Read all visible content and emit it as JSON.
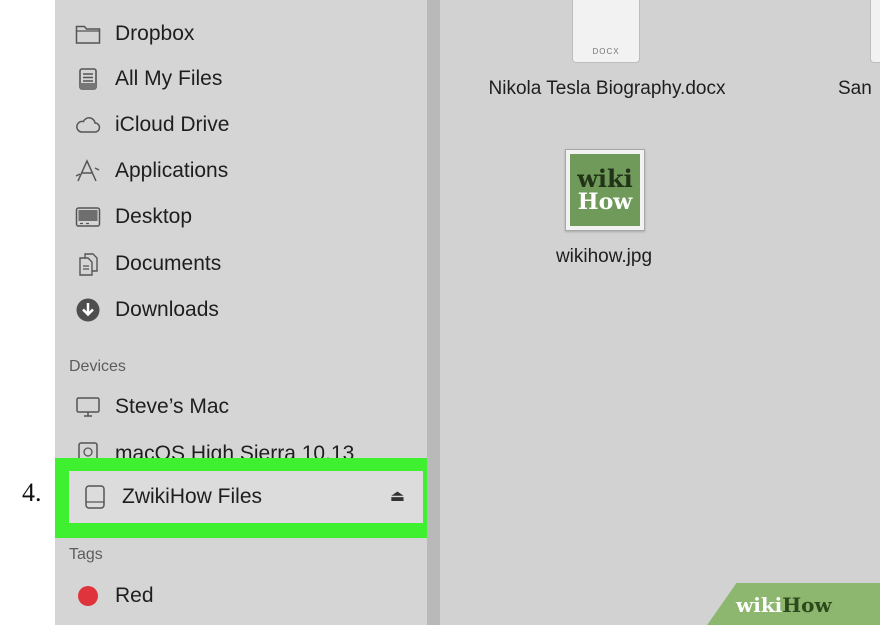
{
  "step": {
    "number": "4."
  },
  "sidebar": {
    "favorites": [
      {
        "label": "Dropbox",
        "icon": "folder-icon"
      },
      {
        "label": "All My Files",
        "icon": "all-files-icon"
      },
      {
        "label": "iCloud Drive",
        "icon": "cloud-icon"
      },
      {
        "label": "Applications",
        "icon": "applications-icon"
      },
      {
        "label": "Desktop",
        "icon": "desktop-icon"
      },
      {
        "label": "Documents",
        "icon": "documents-icon"
      },
      {
        "label": "Downloads",
        "icon": "downloads-icon"
      }
    ],
    "devices_label": "Devices",
    "devices": [
      {
        "label": "Steve’s Mac",
        "icon": "computer-icon"
      },
      {
        "label": "macOS High Sierra 10.13",
        "icon": "disk-icon"
      },
      {
        "label": "ZwikiHow Files",
        "icon": "drive-icon",
        "eject": "⏏",
        "highlighted": true
      }
    ],
    "tags_label": "Tags",
    "tags": [
      {
        "label": "Red",
        "color": "#e0343c"
      }
    ]
  },
  "files": [
    {
      "name": "Nikola Tesla Biography.docx",
      "icon_label": "DOCX"
    },
    {
      "name": "San"
    },
    {
      "name": "wikihow.jpg",
      "thumb_line1": "wiki",
      "thumb_line2": "How"
    }
  ],
  "watermark": {
    "part1": "wiki",
    "part2": "How"
  },
  "colors": {
    "highlight": "#3ef02f",
    "sidebar": "#d5d5d5",
    "content": "#d2d2d2"
  }
}
